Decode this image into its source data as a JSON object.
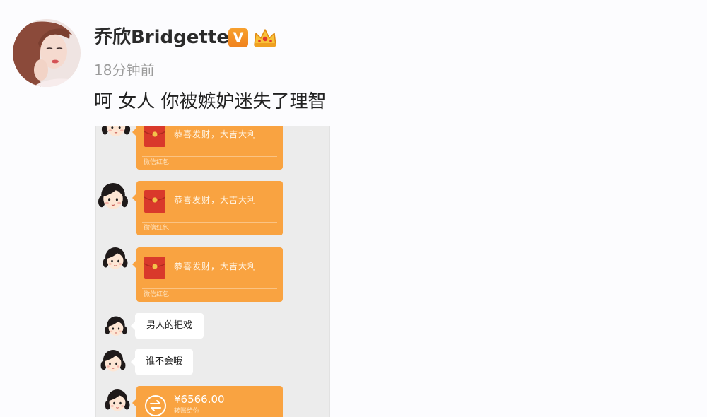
{
  "post": {
    "avatar_icon": "author-avatar-photo",
    "author_name": "乔欣Bridgette",
    "verified_badge": "V",
    "crown_badge_icon": "crown-icon",
    "timestamp": "18分钟前",
    "text": "呵 女人 你被嫉妒迷失了理智"
  },
  "chat_screenshot": {
    "sender_avatar_icon": "cartoon-girl-icon",
    "messages": [
      {
        "icon": "red-envelope-icon",
        "title": "恭喜发财，大吉大利",
        "caption": "微信红包"
      },
      {
        "icon": "red-envelope-icon",
        "title": "恭喜发财，大吉大利",
        "caption": "微信红包"
      },
      {
        "icon": "red-envelope-icon",
        "title": "恭喜发财，大吉大利",
        "caption": "微信红包"
      },
      {
        "text": "男人的把戏"
      },
      {
        "text": "谁不会哦"
      },
      {
        "icon": "transfer-icon",
        "amount": "¥6566.00",
        "caption": "转账给你"
      }
    ]
  },
  "colors": {
    "bubble_orange": "#f9a341",
    "badge_orange": "#f0811d",
    "chat_background": "#ececec",
    "text_primary": "#222222",
    "text_secondary": "#9b9b9b",
    "page_background": "#fcfcfe"
  }
}
